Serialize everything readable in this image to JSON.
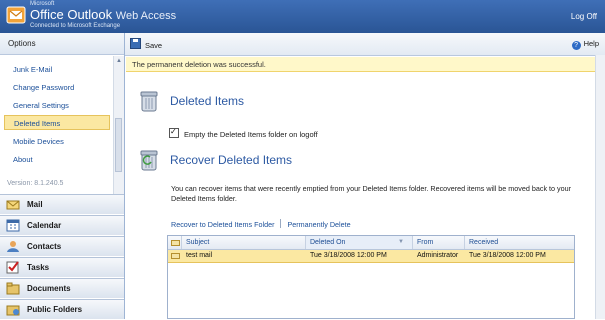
{
  "header": {
    "ms_label": "Microsoft",
    "app_name": "Office Outlook",
    "app_suffix": "Web Access",
    "subtitle": "Connected to Microsoft Exchange",
    "logoff": "Log Off"
  },
  "sidebar": {
    "title": "Options",
    "items": [
      {
        "label": "Junk E-Mail"
      },
      {
        "label": "Change Password"
      },
      {
        "label": "General Settings"
      },
      {
        "label": "Deleted Items",
        "selected": true
      },
      {
        "label": "Mobile Devices"
      },
      {
        "label": "About"
      }
    ],
    "version": "Version: 8.1.240.5",
    "nav": [
      {
        "label": "Mail",
        "icon": "mail-icon"
      },
      {
        "label": "Calendar",
        "icon": "calendar-icon"
      },
      {
        "label": "Contacts",
        "icon": "contacts-icon"
      },
      {
        "label": "Tasks",
        "icon": "tasks-icon"
      },
      {
        "label": "Documents",
        "icon": "documents-icon"
      },
      {
        "label": "Public Folders",
        "icon": "public-folders-icon"
      }
    ]
  },
  "toolbar": {
    "save": "Save",
    "help": "Help"
  },
  "notice": "The permanent deletion was successful.",
  "deleted_items": {
    "title": "Deleted Items",
    "checkbox_label": "Empty the Deleted Items folder on logoff",
    "checked": true
  },
  "recover": {
    "title": "Recover Deleted Items",
    "description": "You can recover items that were recently emptied from your Deleted Items folder. Recovered items will be moved back to your Deleted Items folder.",
    "recover_link": "Recover to Deleted Items Folder",
    "delete_link": "Permanently Delete"
  },
  "grid": {
    "columns": [
      "Subject",
      "Deleted On",
      "From",
      "Received"
    ],
    "sorted_column": "Deleted On",
    "rows": [
      {
        "subject": "test mail",
        "deleted_on": "Tue 3/18/2008 12:00 PM",
        "from": "Administrator",
        "received": "Tue 3/18/2008 12:00 PM"
      }
    ]
  },
  "colors": {
    "header_blue": "#2a5595",
    "selection": "#fbe8a2",
    "link": "#1b4f99",
    "section_title": "#2d5aa3"
  }
}
